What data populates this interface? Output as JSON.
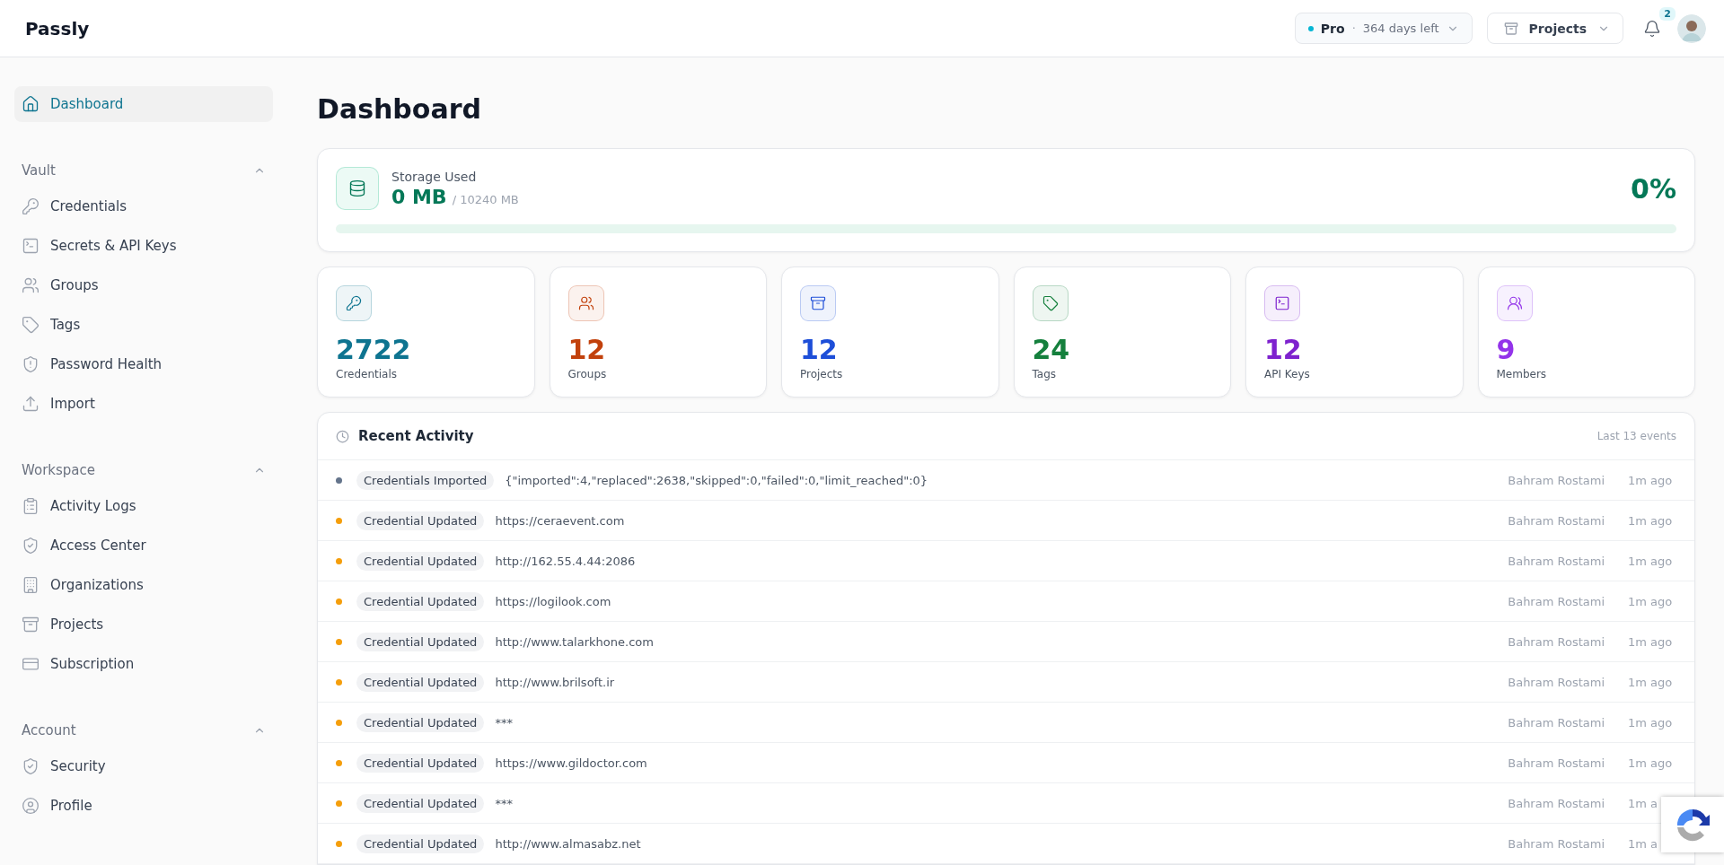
{
  "header": {
    "logo": "Passly",
    "plan": {
      "name": "Pro",
      "separator": "·",
      "remaining": "364 days left"
    },
    "project_menu": {
      "label": "Projects"
    },
    "notifications": {
      "count": "2"
    }
  },
  "sidebar": {
    "top": [
      {
        "label": "Dashboard",
        "kind": "home",
        "selected": true
      }
    ],
    "sections": [
      {
        "title": "Vault",
        "expanded": true,
        "items": [
          {
            "label": "Credentials",
            "kind": "key",
            "selected": false
          },
          {
            "label": "Secrets & API Keys",
            "kind": "terminal",
            "selected": false
          },
          {
            "label": "Groups",
            "kind": "users",
            "selected": false
          },
          {
            "label": "Tags",
            "kind": "tag",
            "selected": false
          },
          {
            "label": "Password Health",
            "kind": "shield-alert",
            "selected": false
          },
          {
            "label": "Import",
            "kind": "upload",
            "selected": false
          }
        ]
      },
      {
        "title": "Workspace",
        "expanded": true,
        "items": [
          {
            "label": "Activity Logs",
            "kind": "clipboard",
            "selected": false
          },
          {
            "label": "Access Center",
            "kind": "shield-check",
            "selected": false
          },
          {
            "label": "Organizations",
            "kind": "building",
            "selected": false
          },
          {
            "label": "Projects",
            "kind": "archive",
            "selected": false
          },
          {
            "label": "Subscription",
            "kind": "card",
            "selected": false
          }
        ]
      },
      {
        "title": "Account",
        "expanded": true,
        "items": [
          {
            "label": "Security",
            "kind": "shield-check",
            "selected": false
          },
          {
            "label": "Profile",
            "kind": "user-circle",
            "selected": false
          }
        ]
      }
    ]
  },
  "page": {
    "title": "Dashboard"
  },
  "storage": {
    "label": "Storage Used",
    "used": "0 MB",
    "total": "/ 10240 MB",
    "percent": "0%",
    "level": 0
  },
  "stats": [
    {
      "value": "2722",
      "label": "Credentials",
      "kind": "key",
      "color": "#0e7490"
    },
    {
      "value": "12",
      "label": "Groups",
      "kind": "users",
      "color": "#c2410c"
    },
    {
      "value": "12",
      "label": "Projects",
      "kind": "archive",
      "color": "#1d4ed8"
    },
    {
      "value": "24",
      "label": "Tags",
      "kind": "tag",
      "color": "#15803d"
    },
    {
      "value": "12",
      "label": "API Keys",
      "kind": "terminal",
      "color": "#7e22ce"
    },
    {
      "value": "9",
      "label": "Members",
      "kind": "users-round",
      "color": "#9333ea"
    }
  ],
  "activity": {
    "title": "Recent Activity",
    "summary": "Last 13 events",
    "events": [
      {
        "action": "Credentials Imported",
        "detail": "{\"imported\":4,\"replaced\":2638,\"skipped\":0,\"failed\":0,\"limit_reached\":0}",
        "user": "Bahram Rostami",
        "time": "1m ago",
        "color": "#64748b"
      },
      {
        "action": "Credential Updated",
        "detail": "https://ceraevent.com",
        "user": "Bahram Rostami",
        "time": "1m ago",
        "color": "#f59e0b"
      },
      {
        "action": "Credential Updated",
        "detail": "http://162.55.4.44:2086",
        "user": "Bahram Rostami",
        "time": "1m ago",
        "color": "#f59e0b"
      },
      {
        "action": "Credential Updated",
        "detail": "https://logilook.com",
        "user": "Bahram Rostami",
        "time": "1m ago",
        "color": "#f59e0b"
      },
      {
        "action": "Credential Updated",
        "detail": "http://www.talarkhone.com",
        "user": "Bahram Rostami",
        "time": "1m ago",
        "color": "#f59e0b"
      },
      {
        "action": "Credential Updated",
        "detail": "http://www.brilsoft.ir",
        "user": "Bahram Rostami",
        "time": "1m ago",
        "color": "#f59e0b"
      },
      {
        "action": "Credential Updated",
        "detail": "***",
        "user": "Bahram Rostami",
        "time": "1m ago",
        "color": "#f59e0b"
      },
      {
        "action": "Credential Updated",
        "detail": "https://www.gildoctor.com",
        "user": "Bahram Rostami",
        "time": "1m ago",
        "color": "#f59e0b"
      },
      {
        "action": "Credential Updated",
        "detail": "***",
        "user": "Bahram Rostami",
        "time": "1m a",
        "color": "#f59e0b"
      },
      {
        "action": "Credential Updated",
        "detail": "http://www.almasabz.net",
        "user": "Bahram Rostami",
        "time": "1m a",
        "color": "#f59e0b"
      }
    ]
  }
}
